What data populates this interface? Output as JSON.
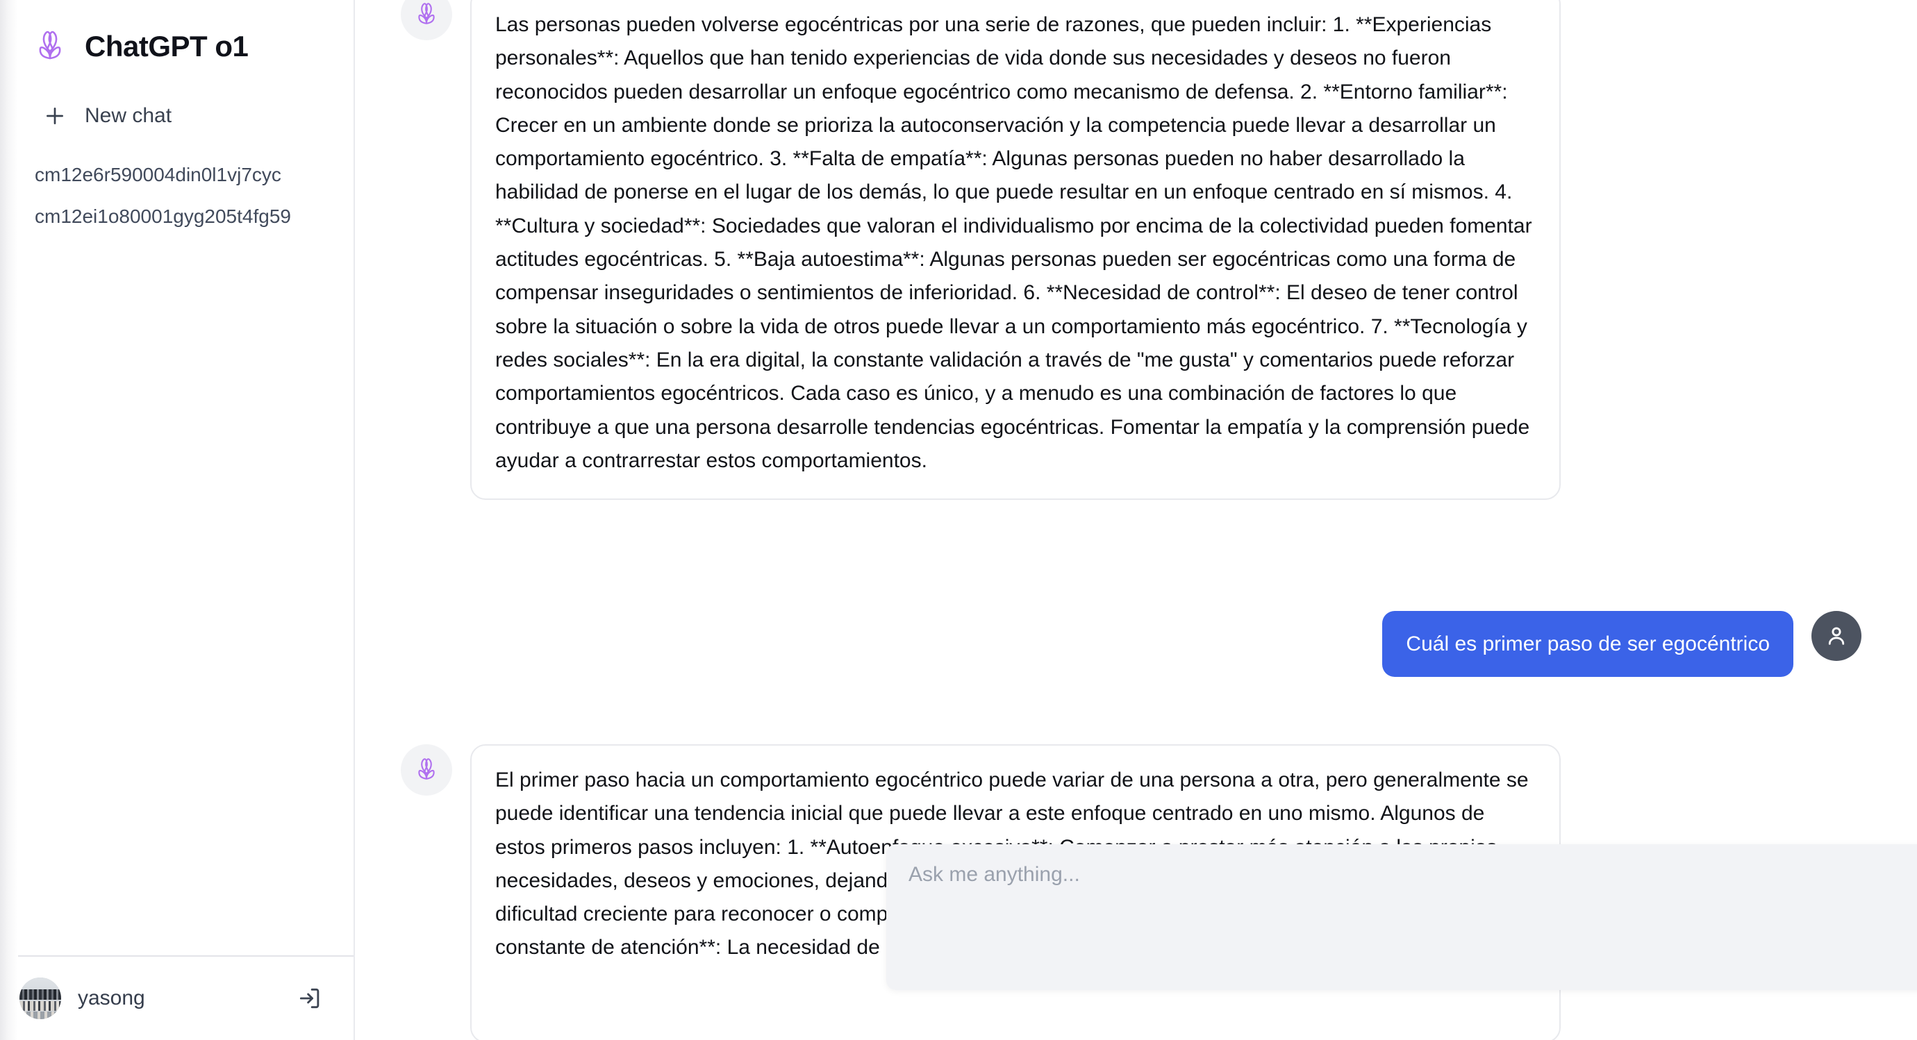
{
  "sidebar": {
    "brand": {
      "title": "ChatGPT o1",
      "logo_icon": "petal-logo-icon"
    },
    "new_chat": {
      "label": "New chat",
      "icon": "plus-icon"
    },
    "chats": [
      {
        "id": "cm12e6r590004din0l1vj7cyc"
      },
      {
        "id": "cm12ei1o80001gyg205t4fg59"
      }
    ],
    "user": {
      "name": "yasong",
      "avatar_icon": "user-photo-avatar",
      "logout_icon": "logout-icon"
    }
  },
  "conversation": {
    "messages": [
      {
        "role": "assistant",
        "avatar_icon": "petal-logo-icon",
        "text": "Las personas pueden volverse egocéntricas por una serie de razones, que pueden incluir: 1. **Experiencias personales**: Aquellos que han tenido experiencias de vida donde sus necesidades y deseos no fueron reconocidos pueden desarrollar un enfoque egocéntrico como mecanismo de defensa. 2. **Entorno familiar**: Crecer en un ambiente donde se prioriza la autoconservación y la competencia puede llevar a desarrollar un comportamiento egocéntrico. 3. **Falta de empatía**: Algunas personas pueden no haber desarrollado la habilidad de ponerse en el lugar de los demás, lo que puede resultar en un enfoque centrado en sí mismos. 4. **Cultura y sociedad**: Sociedades que valoran el individualismo por encima de la colectividad pueden fomentar actitudes egocéntricas. 5. **Baja autoestima**: Algunas personas pueden ser egocéntricas como una forma de compensar inseguridades o sentimientos de inferioridad. 6. **Necesidad de control**: El deseo de tener control sobre la situación o sobre la vida de otros puede llevar a un comportamiento más egocéntrico. 7. **Tecnología y redes sociales**: En la era digital, la constante validación a través de \"me gusta\" y comentarios puede reforzar comportamientos egocéntricos. Cada caso es único, y a menudo es una combinación de factores lo que contribuye a que una persona desarrolle tendencias egocéntricas. Fomentar la empatía y la comprensión puede ayudar a contrarrestar estos comportamientos."
      },
      {
        "role": "user",
        "avatar_icon": "person-icon",
        "text": "Cuál es primer paso de ser egocéntrico"
      },
      {
        "role": "assistant",
        "avatar_icon": "petal-logo-icon",
        "text": "El primer paso hacia un comportamiento egocéntrico puede variar de una persona a otra, pero generalmente se puede identificar una tendencia inicial que puede llevar a este enfoque centrado en uno mismo. Algunos de estos primeros pasos incluyen: 1. **Autoenfoque excesivo**: Comenzar a prestar más atención a las propias necesidades, deseos y emociones, dejando de lado las de los demás. 2. **Disminución de la empatía**: Una dificultad creciente para reconocer o comprender las emociones y necesidades de los demás. 3. **Búsqueda constante de atención**: La necesidad de ser el centro de atención o recibir"
      }
    ]
  },
  "composer": {
    "placeholder": "Ask me anything...",
    "value": "",
    "send_icon": "send-paper-plane-icon",
    "resize_handle_icon": "resize-grip-icon"
  },
  "colors": {
    "user_bubble": "#3b63e8",
    "send_button": "#4b43db",
    "logo_purple": "#b070ef",
    "sidebar_border": "#e9eaee",
    "card_border": "#e8e9ed",
    "composer_bg": "#f2f3f6"
  }
}
